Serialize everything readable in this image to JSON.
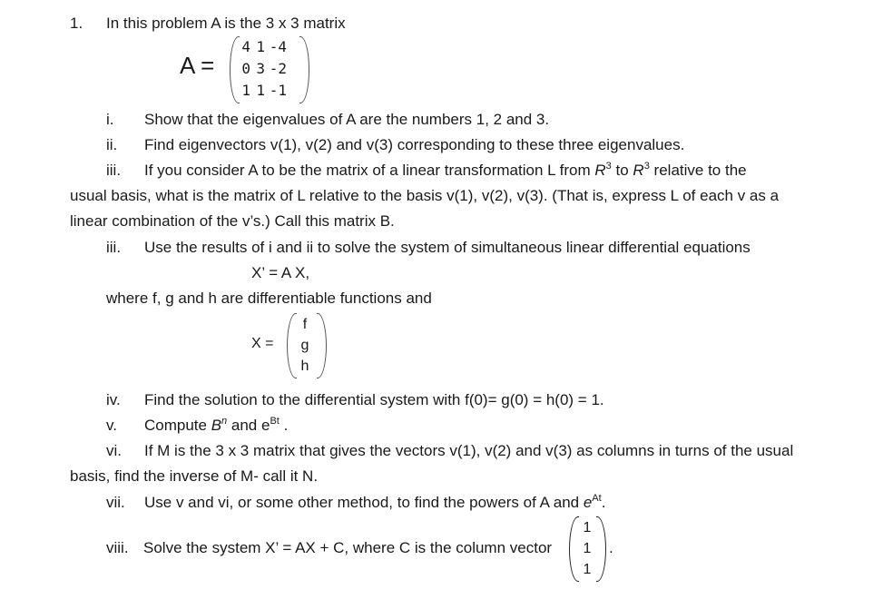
{
  "problem": {
    "number": "1.",
    "intro": "In this problem A is the 3 x 3 matrix",
    "matrix_A": {
      "label": "A =",
      "rows": [
        [
          "4",
          "1",
          "-4"
        ],
        [
          "0",
          "3",
          "-2"
        ],
        [
          "1",
          "1",
          "-1"
        ]
      ]
    },
    "items": {
      "i": {
        "label": "i.",
        "text": "Show that the eigenvalues of A are the numbers 1, 2 and 3."
      },
      "ii": {
        "label": "ii.",
        "text": "Find eigenvectors v(1), v(2) and v(3) corresponding to these three eigenvalues."
      },
      "iii_a": {
        "label": "iii.",
        "text_pre": "If you consider A to be the matrix of a linear transformation L from ",
        "R": "R",
        "exp": "3",
        "text_mid": " to ",
        "text_post": " relative to the",
        "line2": "usual basis, what is the matrix of L relative to the basis v(1), v(2), v(3). (That is, express L of each v as a",
        "line3": "linear combination of the v’s.) Call this matrix B."
      },
      "iii_b": {
        "label": "iii.",
        "text": "Use the results of i and ii to solve the system of simultaneous linear differential equations",
        "equation": "X’ = A X,",
        "where": "where f, g and h are differentiable functions and",
        "vector_label": "X =",
        "vector": [
          "f",
          "g",
          "h"
        ]
      },
      "iv": {
        "label": "iv.",
        "text": "Find the solution to the differential system with f(0)= g(0) = h(0) = 1."
      },
      "v": {
        "label": "v.",
        "pre": "Compute ",
        "B": "B",
        "B_exp": "n",
        "mid": " and e",
        "e_exp": "Bt",
        "post": " ."
      },
      "vi": {
        "label": "vi.",
        "text": "If M is the 3 x 3 matrix that gives the vectors v(1), v(2) and v(3) as columns in turns of the usual",
        "line2": "basis, find the inverse of M- call it N."
      },
      "vii": {
        "label": "vii.",
        "pre": "Use v and vi, or some other method, to find the powers of A and ",
        "e": "e",
        "exp": "At",
        "post": "."
      },
      "viii": {
        "label": "viii.",
        "text": "Solve the system X’ =  AX + C, where C is the column vector",
        "vector": [
          "1",
          "1",
          "1"
        ],
        "post": "."
      }
    }
  }
}
